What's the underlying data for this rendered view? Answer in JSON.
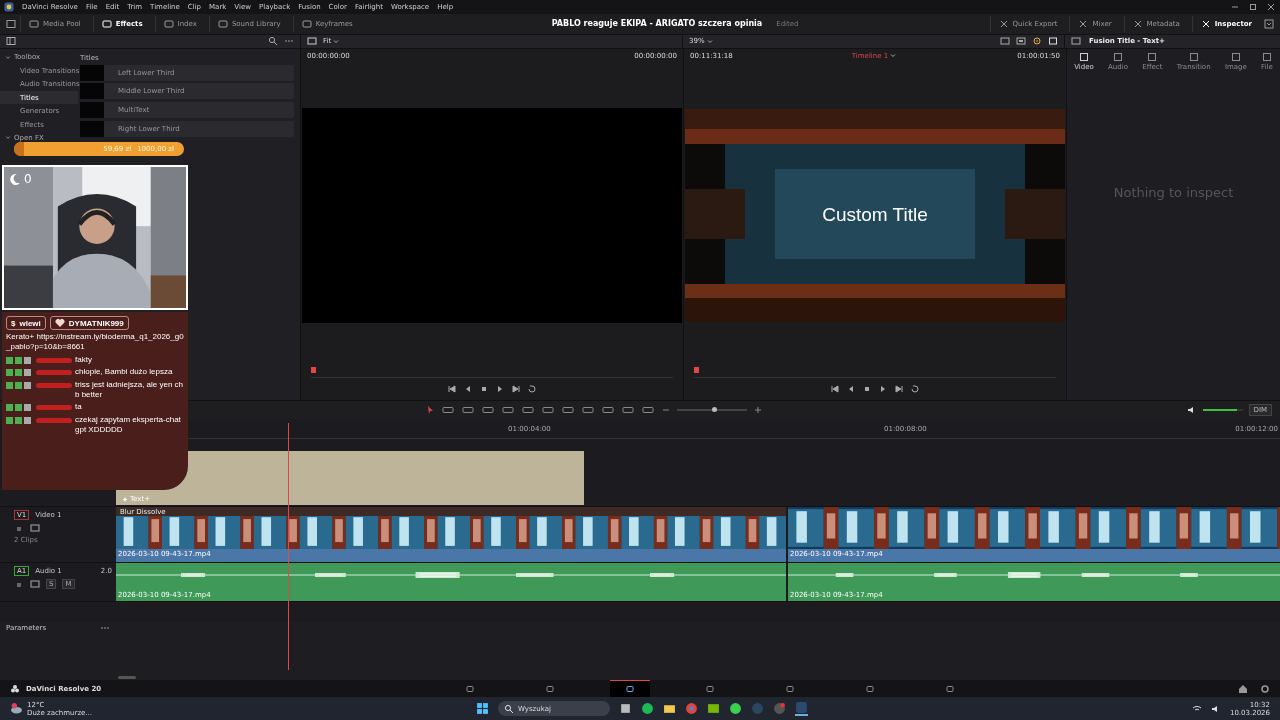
{
  "menu_bar": {
    "app": "DaVinci Resolve",
    "items": [
      "File",
      "Edit",
      "Trim",
      "Timeline",
      "Clip",
      "Mark",
      "View",
      "Playback",
      "Fusion",
      "Color",
      "Fairlight",
      "Workspace",
      "Help"
    ]
  },
  "toolbar": {
    "left": [
      {
        "label": "Media Pool",
        "selected": false
      },
      {
        "label": "Effects",
        "selected": true
      },
      {
        "label": "Index",
        "selected": false
      },
      {
        "label": "Sound Library",
        "selected": false
      },
      {
        "label": "Keyframes",
        "selected": false
      }
    ],
    "project_title": "PABLO reaguje EKIPA - ARIGATO szczera opinia",
    "status": "Edited",
    "right": [
      {
        "label": "Quick Export",
        "selected": false
      },
      {
        "label": "Mixer",
        "selected": false
      },
      {
        "label": "Metadata",
        "selected": false
      },
      {
        "label": "Inspector",
        "selected": true
      }
    ]
  },
  "effects_panel": {
    "tree": [
      {
        "label": "Toolbox",
        "expanded": true,
        "children": [
          {
            "label": "Video Transitions",
            "selected": false
          },
          {
            "label": "Audio Transitions",
            "selected": false
          },
          {
            "label": "Titles",
            "selected": true
          },
          {
            "label": "Generators",
            "selected": false
          },
          {
            "label": "Effects",
            "selected": false
          }
        ]
      },
      {
        "label": "Open FX",
        "expanded": true
      }
    ],
    "section": "Titles",
    "items": [
      "Left Lower Third",
      "Middle Lower Third",
      "MultiText",
      "Right Lower Third"
    ]
  },
  "source_viewer": {
    "zoom": "Fit",
    "timecode_left": "00:00:00:00",
    "timecode_right": "00:00:00:00"
  },
  "timeline_viewer": {
    "zoom": "39%",
    "timecode": "00:11:31:18",
    "timeline": "Timeline 1",
    "duration": "01:00:01:50",
    "title_text": "Custom Title"
  },
  "inspector": {
    "title": "Fusion Title - Text+",
    "tabs": [
      {
        "label": "Video",
        "selected": true
      },
      {
        "label": "Audio",
        "selected": false
      },
      {
        "label": "Effect",
        "selected": false
      },
      {
        "label": "Transition",
        "selected": false
      },
      {
        "label": "Image",
        "selected": false
      },
      {
        "label": "File",
        "selected": false
      }
    ],
    "empty_message": "Nothing to inspect"
  },
  "timeline": {
    "ruler": [
      "01:00:04:00",
      "01:00:08:00",
      "01:00:12:00"
    ],
    "volume": {
      "level": 0.85
    },
    "dim": "DIM",
    "title_track": {
      "clip": "Text+"
    },
    "video_track": {
      "id": "V1",
      "name": "Video 1",
      "clips_count": "2 Clips",
      "transition": "Blur Dissolve",
      "clips": [
        "2026-03-10 09-43-17.mp4",
        "2026-03-10 09-43-17.mp4"
      ]
    },
    "audio_track": {
      "id": "A1",
      "name": "Audio 1",
      "channels": "2.0",
      "solo": "S",
      "mute": "M",
      "clips": [
        "2026-03-10 09-43-17.mp4",
        "2026-03-10 09-43-17.mp4"
      ]
    }
  },
  "parameters": {
    "label": "Parameters"
  },
  "page_bar": {
    "app": "DaVinci Resolve 20",
    "pages": [
      {
        "selected": false
      },
      {
        "selected": false
      },
      {
        "selected": true
      },
      {
        "selected": false
      },
      {
        "selected": false
      },
      {
        "selected": false
      },
      {
        "selected": false
      }
    ]
  },
  "stream_overlay": {
    "goal": {
      "amount": "59,69 zł",
      "target": "1000,00 zł",
      "level": 0.06
    },
    "camera": {
      "counter": "0"
    },
    "chat": {
      "pills": [
        "$",
        "wlewi",
        "DYMATNIK999"
      ],
      "messages": [
        {
          "kind": "plain",
          "text": "Kerato+ https://instream.ly/bioderma_q1_2026_g0_pablo?p=10&b=8661"
        },
        {
          "kind": "user",
          "text": "fakty"
        },
        {
          "kind": "user",
          "text": "chłopie, Bambi dużo lepsza"
        },
        {
          "kind": "user",
          "text": "triss jest ładniejsza, ale yen chb better"
        },
        {
          "kind": "user",
          "text": "ta"
        },
        {
          "kind": "user",
          "text": "czekaj zapytam eksperta-chat gpt XDDDDD"
        }
      ]
    }
  },
  "taskbar": {
    "weather": "12°C",
    "forecast": "Duże zachmurze...",
    "search": "Wyszukaj",
    "time": "10:32",
    "date": "10.03.2026"
  }
}
